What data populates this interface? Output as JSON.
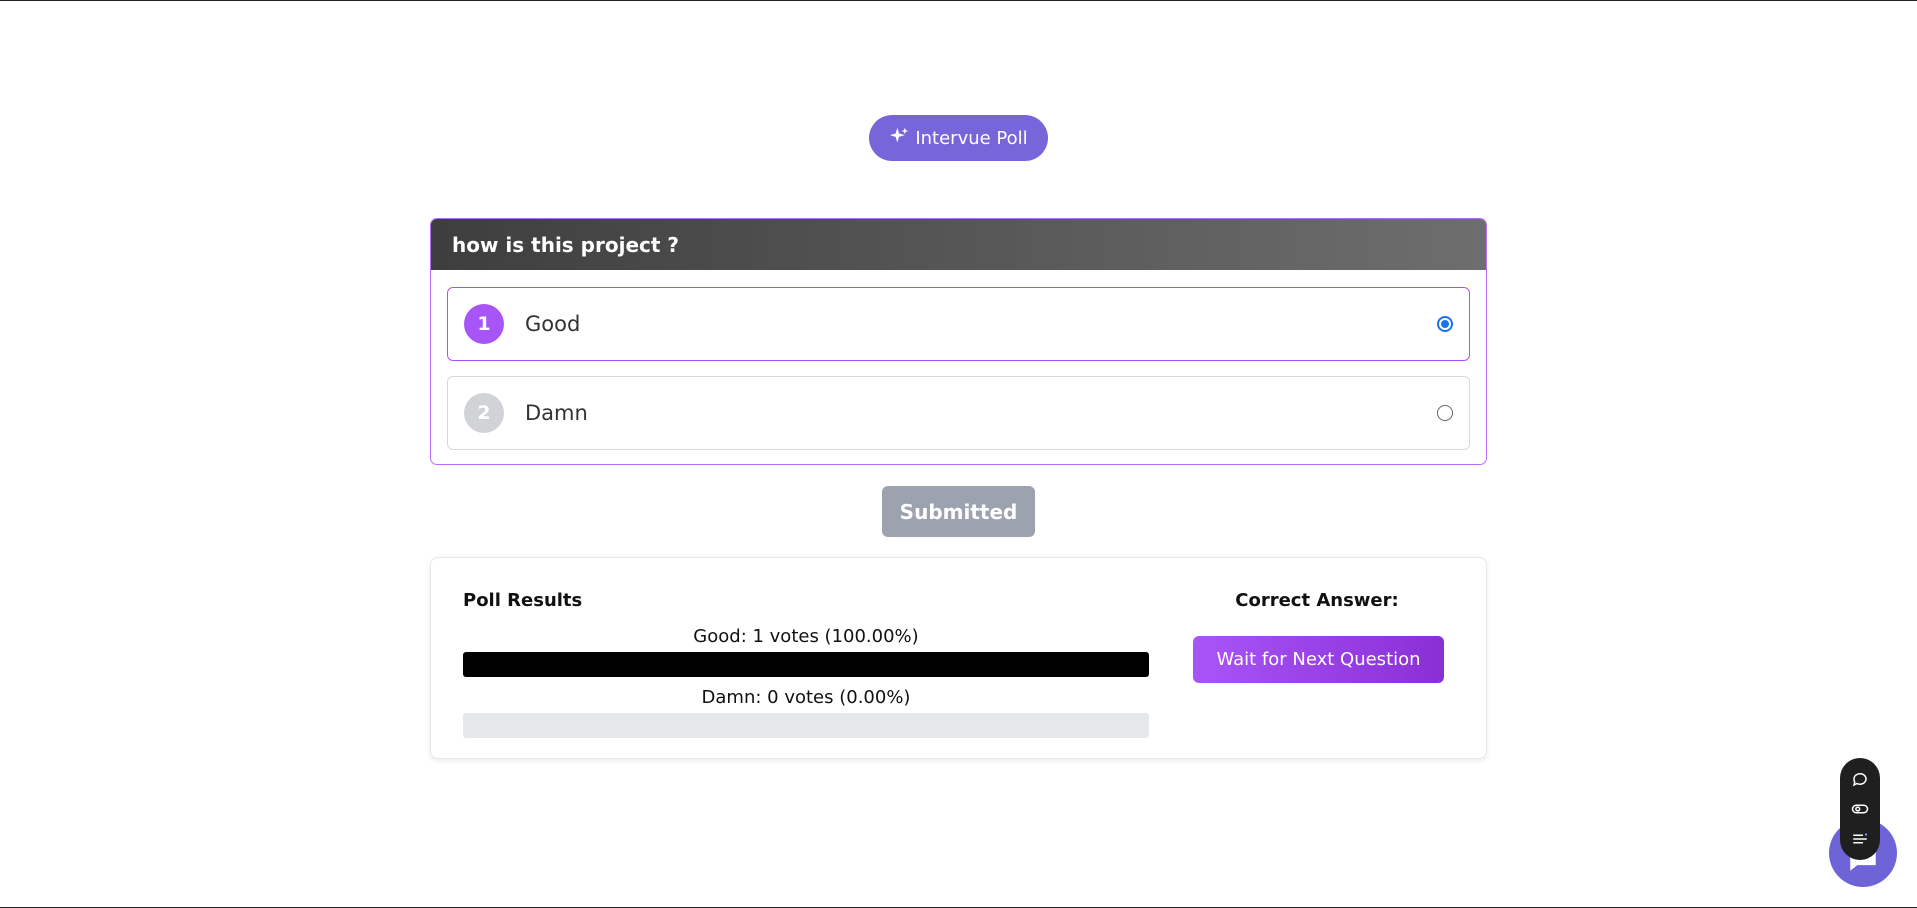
{
  "brand": {
    "label": "Intervue Poll",
    "icon": "sparkle-icon",
    "color": "#7765DA"
  },
  "question": {
    "text": "how is this project ?",
    "options": [
      {
        "number": "1",
        "label": "Good",
        "selected": true
      },
      {
        "number": "2",
        "label": "Damn",
        "selected": false
      }
    ]
  },
  "submit": {
    "label": "Submitted"
  },
  "results": {
    "title": "Poll Results",
    "items": [
      {
        "label": "Good: 1 votes (100.00%)",
        "percent": 100
      },
      {
        "label": "Damn: 0 votes (0.00%)",
        "percent": 0
      }
    ],
    "correct_title": "Correct Answer:",
    "wait_button": "Wait for Next Question"
  },
  "floating_tools": {
    "icons": [
      "chat-bubble-icon",
      "toggle-icon",
      "list-icon"
    ],
    "fab_icon": "chat-icon"
  },
  "colors": {
    "accent": "#a855f7",
    "radio": "#1a73e8",
    "fab": "#6f63d8"
  }
}
